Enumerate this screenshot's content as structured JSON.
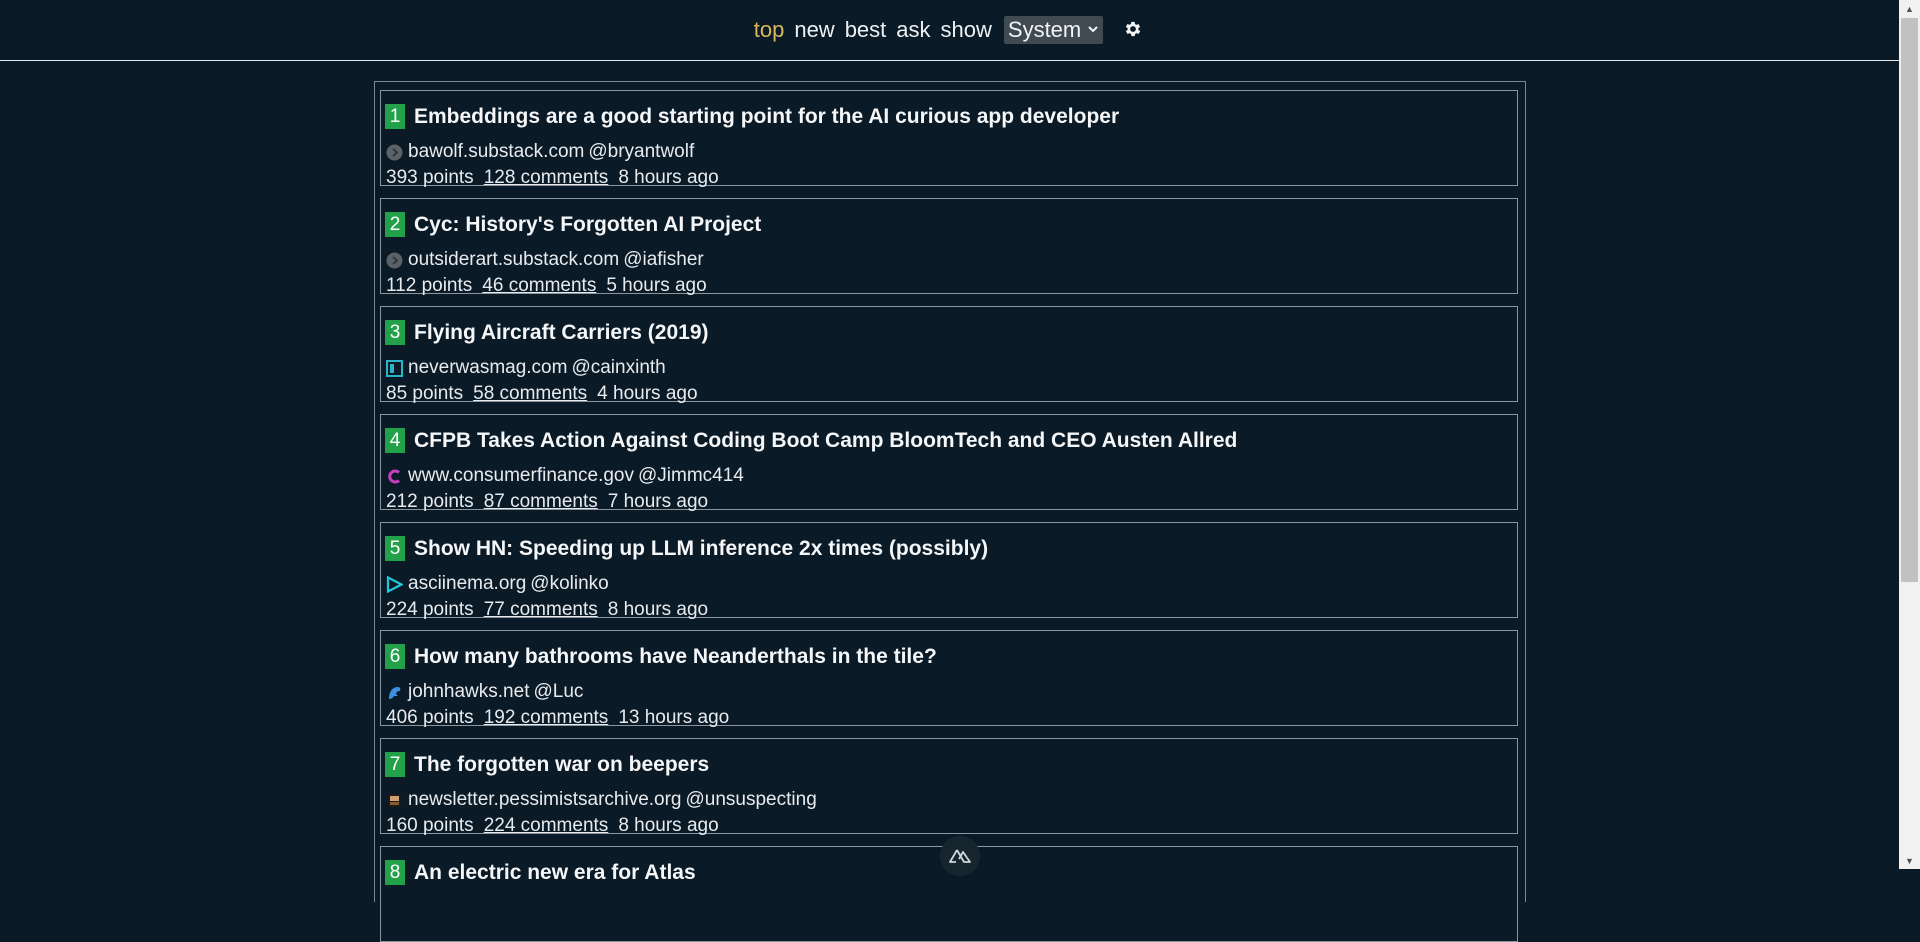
{
  "nav": {
    "links": [
      "top",
      "new",
      "best",
      "ask",
      "show"
    ],
    "theme_value": "System",
    "gear_icon": "gear-icon"
  },
  "colors": {
    "background": "#0b1a27",
    "active_link": "#d8b85a",
    "rank_badge": "#23a04a"
  },
  "stories": [
    {
      "rank": "1",
      "title": "Embeddings are a good starting point for the AI curious app developer",
      "domain": "bawolf.substack.com",
      "author": "@bryantwolf",
      "points": "393 points",
      "comments": "128 comments",
      "age": "8 hours ago",
      "favicon": "substack-default-icon"
    },
    {
      "rank": "2",
      "title": "Cyc: History's Forgotten AI Project",
      "domain": "outsiderart.substack.com",
      "author": "@iafisher",
      "points": "112 points",
      "comments": "46 comments",
      "age": "5 hours ago",
      "favicon": "substack-default-icon"
    },
    {
      "rank": "3",
      "title": "Flying Aircraft Carriers (2019)",
      "domain": "neverwasmag.com",
      "author": "@cainxinth",
      "points": "85 points",
      "comments": "58 comments",
      "age": "4 hours ago",
      "favicon": "neverwas-icon"
    },
    {
      "rank": "4",
      "title": "CFPB Takes Action Against Coding Boot Camp BloomTech and CEO Austen Allred",
      "domain": "www.consumerfinance.gov",
      "author": "@Jimmc414",
      "points": "212 points",
      "comments": "87 comments",
      "age": "7 hours ago",
      "favicon": "cfpb-icon"
    },
    {
      "rank": "5",
      "title": "Show HN: Speeding up LLM inference 2x times (possibly)",
      "domain": "asciinema.org",
      "author": "@kolinko",
      "points": "224 points",
      "comments": "77 comments",
      "age": "8 hours ago",
      "favicon": "asciinema-play-icon"
    },
    {
      "rank": "6",
      "title": "How many bathrooms have Neanderthals in the tile?",
      "domain": "johnhawks.net",
      "author": "@Luc",
      "points": "406 points",
      "comments": "192 comments",
      "age": "13 hours ago",
      "favicon": "johnhawks-icon"
    },
    {
      "rank": "7",
      "title": "The forgotten war on beepers",
      "domain": "newsletter.pessimistsarchive.org",
      "author": "@unsuspecting",
      "points": "160 points",
      "comments": "224 comments",
      "age": "8 hours ago",
      "favicon": "pessimists-icon"
    },
    {
      "rank": "8",
      "title": "An electric new era for Atlas",
      "domain": "",
      "author": "",
      "points": "",
      "comments": "",
      "age": "",
      "favicon": ""
    }
  ]
}
